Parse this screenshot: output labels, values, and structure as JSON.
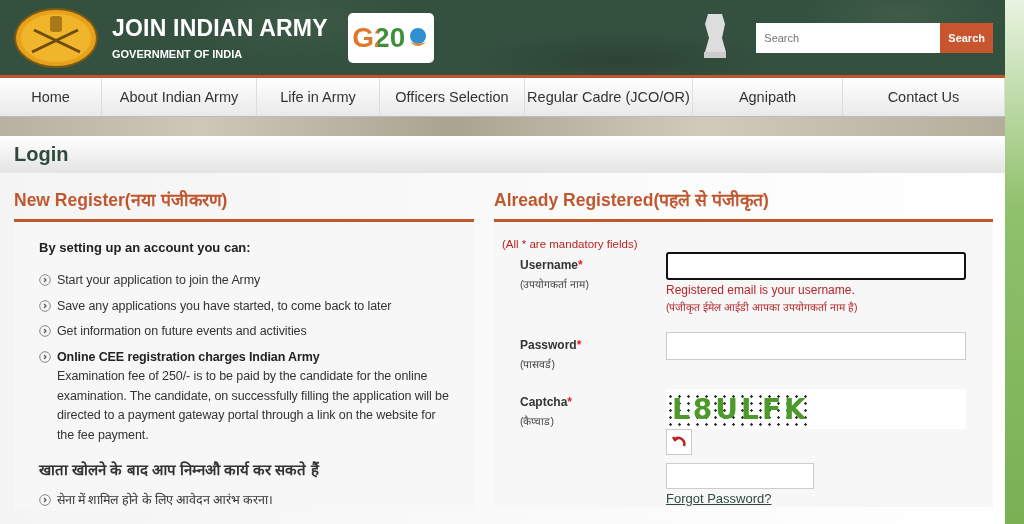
{
  "header": {
    "title": "JOIN INDIAN ARMY",
    "subtitle": "GOVERNMENT OF INDIA",
    "g20_logo": "G20",
    "search": {
      "placeholder": "Search",
      "button": "Search"
    }
  },
  "nav": [
    {
      "label": "Home"
    },
    {
      "label": "About Indian Army"
    },
    {
      "label": "Life in Army"
    },
    {
      "label": "Officers Selection"
    },
    {
      "label": "Regular Cadre (JCO/OR)"
    },
    {
      "label": "Agnipath"
    },
    {
      "label": "Contact Us"
    }
  ],
  "page_title": "Login",
  "new_register": {
    "heading": "New Register(नया पंजीकरण)",
    "intro": "By setting up an account you can:",
    "items": [
      {
        "text": "Start your application to join the Army"
      },
      {
        "text": "Save any applications you have started, to come back to later"
      },
      {
        "text": "Get information on future events and activities"
      },
      {
        "title": "Online CEE registration charges Indian Army",
        "text": "Examination fee of 250/- is to be paid by the candidate for the online examination. The candidate, on successfully filling the application will be directed to a payment gateway portal through a link on the website for the fee payment."
      }
    ],
    "hindi_intro": "खाता खोलने के बाद आप निम्नऔ कार्य कर सकते हैं",
    "hindi_items": [
      {
        "text": "सेना में शामिल होने के लिए आवेदन आरंभ करना।"
      }
    ]
  },
  "login": {
    "heading": "Already Registered(पहले से पंजीकृत)",
    "mandatory_note": "(All * are mandatory fields)",
    "username": {
      "label": "Username",
      "required_mark": "*",
      "hindi": "(उपयोगकर्ता नाम)",
      "focused": true,
      "hint": "Registered email is your username.",
      "hint_hindi": "(पंजीकृत ईमेल आईडी आपका उपयोगकर्ता नाम है)"
    },
    "password": {
      "label": "Password",
      "required_mark": "*",
      "hindi": "(पासवर्ड)"
    },
    "captcha": {
      "label": "Captcha",
      "required_mark": "*",
      "hindi": "(कैप्चाड)",
      "code": "L8ULFK"
    },
    "forgot_link": "Forgot Password?"
  }
}
